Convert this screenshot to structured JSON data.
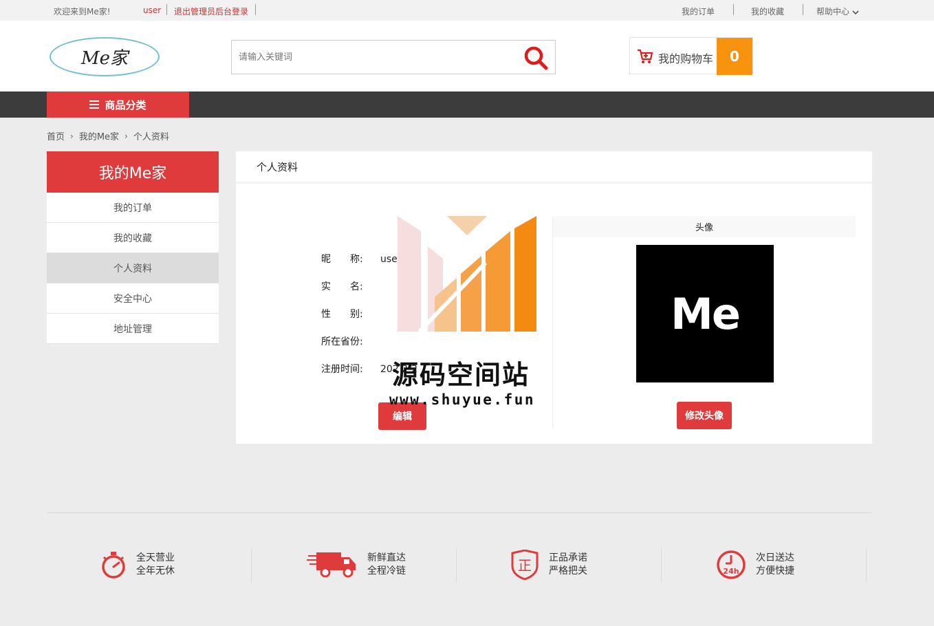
{
  "topbar": {
    "welcome": "欢迎来到Me家!",
    "username": "user",
    "logout": "退出管理员后台登录",
    "orders": "我的订单",
    "favorites": "我的收藏",
    "help": "帮助中心"
  },
  "header": {
    "logo_text": "Me家",
    "search_placeholder": "请输入关键词",
    "cart_label": "我的购物车",
    "cart_count": "0"
  },
  "nav": {
    "category_label": "商品分类"
  },
  "breadcrumb": [
    "首页",
    "我的Me家",
    "个人资料"
  ],
  "sidebar": {
    "title": "我的Me家",
    "items": [
      {
        "label": "我的订单"
      },
      {
        "label": "我的收藏"
      },
      {
        "label": "个人资料",
        "active": true
      },
      {
        "label": "安全中心"
      },
      {
        "label": "地址管理"
      }
    ]
  },
  "profile": {
    "panel_title": "个人资料",
    "fields": [
      {
        "label": "昵　　称:",
        "value": "use"
      },
      {
        "label": "实　　名:",
        "value": ""
      },
      {
        "label": "性　　别:",
        "value": ""
      },
      {
        "label": "所在省份:",
        "value": ""
      },
      {
        "label": "注册时间:",
        "value": "202 2-2"
      }
    ],
    "edit_button": "编辑",
    "avatar_title": "头像",
    "avatar_text": "Me",
    "avatar_button": "修改头像"
  },
  "watermark": {
    "title": "源码空间站",
    "url": "www.shuyue.fun"
  },
  "services": [
    {
      "line1": "全天营业",
      "line2": "全年无休",
      "icon": "stopwatch-icon"
    },
    {
      "line1": "新鲜直达",
      "line2": "全程冷链",
      "icon": "delivery-truck-icon"
    },
    {
      "line1": "正品承诺",
      "line2": "严格把关",
      "icon": "genuine-shield-icon"
    },
    {
      "line1": "次日送达",
      "line2": "方便快捷",
      "icon": "clock-24h-icon"
    }
  ],
  "colors": {
    "accent": "#e03b3c",
    "cart_badge": "#f7930f",
    "nav_bg": "#3c3c3c"
  }
}
